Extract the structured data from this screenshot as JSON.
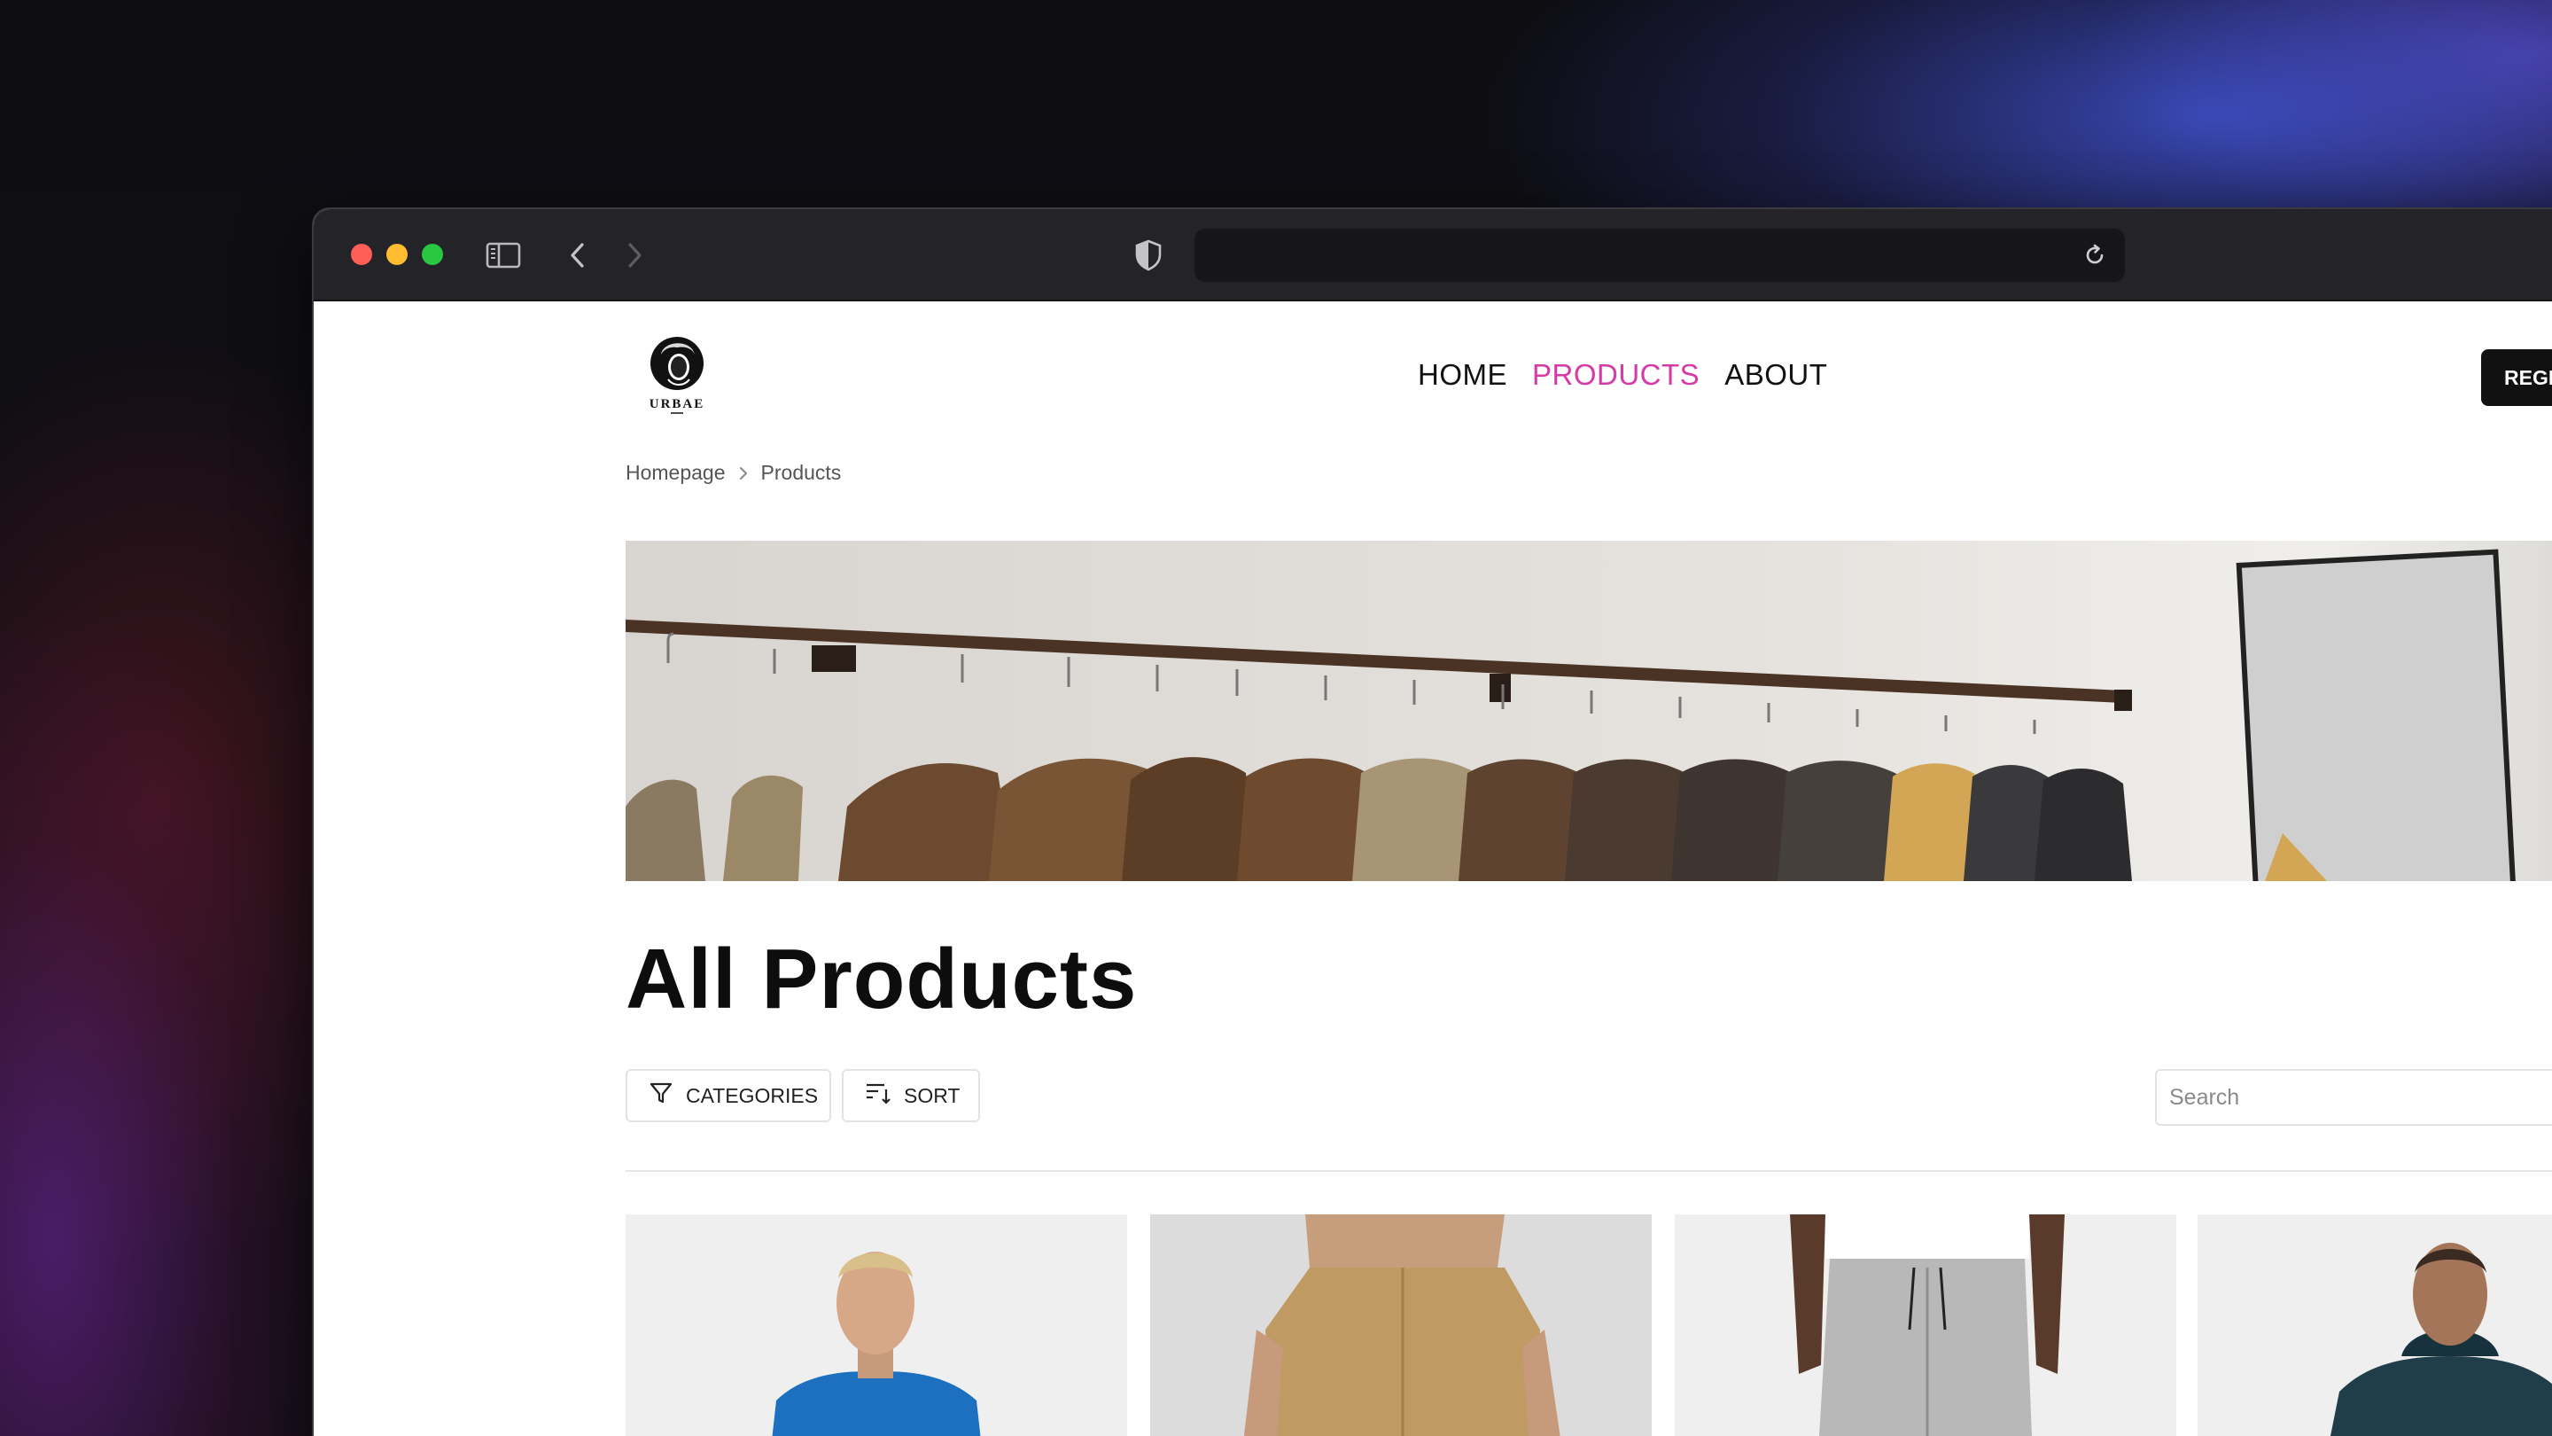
{
  "browser": {
    "address": "",
    "icons": [
      "sidebar-icon",
      "back-arrow-icon",
      "forward-arrow-icon",
      "shield-icon",
      "reload-icon"
    ]
  },
  "site": {
    "logo_text": "URBAE",
    "nav": [
      {
        "label": "HOME",
        "active": false
      },
      {
        "label": "PRODUCTS",
        "active": true
      },
      {
        "label": "ABOUT",
        "active": false
      }
    ],
    "register_label": "REGI",
    "accent_color": "#d63aa6"
  },
  "breadcrumb": {
    "items": [
      "Homepage",
      "Products"
    ]
  },
  "main": {
    "title": "All Products",
    "categories_label": "CATEGORIES",
    "sort_label": "SORT",
    "search_placeholder": "Search"
  },
  "products": [
    {
      "image": "man-blue-tshirt"
    },
    {
      "image": "khaki-cargo-pants"
    },
    {
      "image": "grey-joggers"
    },
    {
      "image": "navy-hooded-jacket"
    }
  ]
}
